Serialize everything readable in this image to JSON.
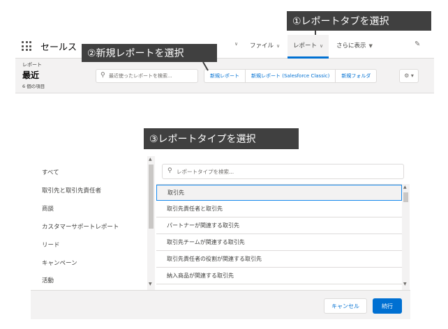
{
  "callouts": {
    "step1": "①レポートタブを選択",
    "step2": "②新規レポートを選択",
    "step3": "③レポートタイプを選択"
  },
  "nav": {
    "app_name": "セールス",
    "items": [
      {
        "label": "ファイル"
      },
      {
        "label": "レポート",
        "active": true
      },
      {
        "label": "さらに表示"
      }
    ],
    "chevron": "∨",
    "more_caret": "▼",
    "launcher_icon": "app-launcher-icon",
    "edit_icon": "pencil-icon"
  },
  "list_header": {
    "object_label": "レポート",
    "title": "最近",
    "item_count": "6 個の項目",
    "search_placeholder": "最近使ったレポートを検索...",
    "buttons": [
      "新規レポート",
      "新規レポート (Salesforce Classic)",
      "新規フォルダ"
    ],
    "gear_label": "⚙ ▾"
  },
  "report_type_dialog": {
    "categories": [
      "すべて",
      "取引先と取引先責任者",
      "商談",
      "カスタマーサポートレポート",
      "リード",
      "キャンペーン",
      "活動"
    ],
    "search_placeholder": "レポートタイプを検索...",
    "report_types": [
      "取引先",
      "取引先責任者と取引先",
      "パートナーが関連する取引先",
      "取引先チームが関連する取引先",
      "取引先責任者の役割が関連する取引先",
      "納入商品が関連する取引先"
    ],
    "selected_index": 0,
    "cancel_label": "キャンセル",
    "continue_label": "続行"
  },
  "colors": {
    "brand_blue": "#0070d2",
    "callout_bg": "#404040",
    "header_bg": "#f3f2f2"
  }
}
